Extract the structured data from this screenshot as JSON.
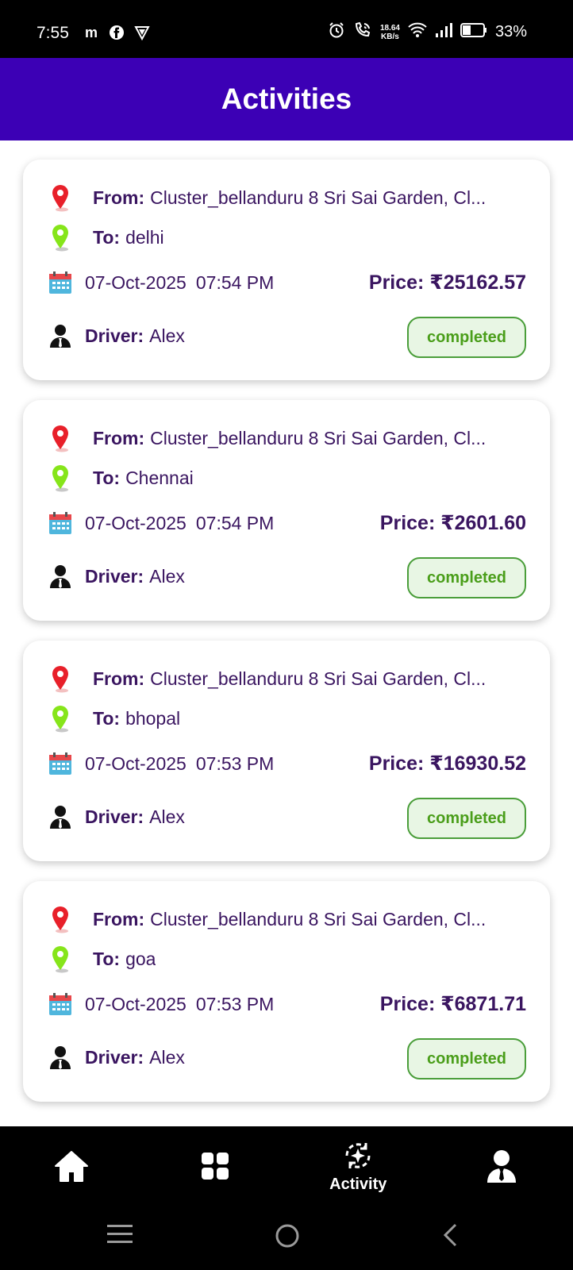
{
  "status_bar": {
    "time": "7:55",
    "net_speed_value": "18.64",
    "net_speed_unit": "KB/s",
    "battery_percent": "33%"
  },
  "header": {
    "title": "Activities"
  },
  "labels": {
    "from": "From:",
    "to": "To:",
    "price": "Price:",
    "driver": "Driver:"
  },
  "activities": [
    {
      "from": "Cluster_bellanduru 8 Sri Sai Garden, Cl...",
      "to": "delhi",
      "date": "07-Oct-2025",
      "time": "07:54 PM",
      "price": "₹25162.57",
      "driver": "Alex",
      "status": "completed"
    },
    {
      "from": "Cluster_bellanduru 8 Sri Sai Garden, Cl...",
      "to": "Chennai",
      "date": "07-Oct-2025",
      "time": "07:54 PM",
      "price": "₹2601.60",
      "driver": "Alex",
      "status": "completed"
    },
    {
      "from": "Cluster_bellanduru 8 Sri Sai Garden, Cl...",
      "to": "bhopal",
      "date": "07-Oct-2025",
      "time": "07:53 PM",
      "price": "₹16930.52",
      "driver": "Alex",
      "status": "completed"
    },
    {
      "from": "Cluster_bellanduru 8 Sri Sai Garden, Cl...",
      "to": "goa",
      "date": "07-Oct-2025",
      "time": "07:53 PM",
      "price": "₹6871.71",
      "driver": "Alex",
      "status": "completed"
    }
  ],
  "bottom_nav": {
    "items": [
      {
        "icon": "home-icon",
        "label": ""
      },
      {
        "icon": "grid-icon",
        "label": ""
      },
      {
        "icon": "activity-icon",
        "label": "Activity"
      },
      {
        "icon": "account-icon",
        "label": ""
      }
    ]
  },
  "colors": {
    "header_bg": "#3c00b5",
    "text_primary": "#3a1560",
    "status_green": "#4a9e1a",
    "pin_from": "#e8202a",
    "pin_to": "#86e51a"
  }
}
